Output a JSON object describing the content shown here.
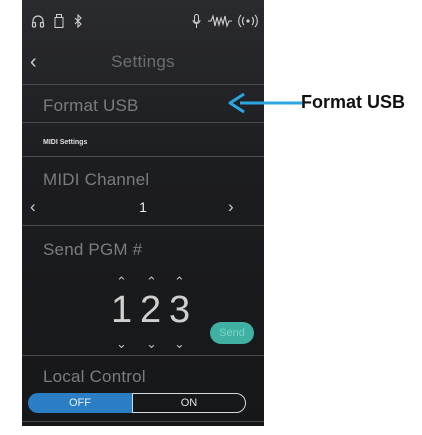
{
  "header": {
    "title": "Settings"
  },
  "statusbar": {
    "icons": [
      "headphones-icon",
      "usb-stick-icon",
      "bluetooth-icon",
      "microphone-icon",
      "waveform-icon",
      "wireless-icon"
    ]
  },
  "format_usb": {
    "label": "Format USB"
  },
  "midi_section": {
    "heading": "MIDI Settings",
    "channel_label": "MIDI Channel",
    "channel_value": "1"
  },
  "send_pgm": {
    "label": "Send PGM #",
    "digits": [
      "1",
      "2",
      "3"
    ],
    "send_label": "Send"
  },
  "local_control": {
    "label": "Local Control",
    "off_label": "OFF",
    "on_label": "ON",
    "selected": "OFF"
  },
  "annotation": {
    "label": "Format USB",
    "color": "#2aa7e3"
  },
  "colors": {
    "accent_blue": "#2b7ec4",
    "send_teal": "#3fb0a2"
  }
}
